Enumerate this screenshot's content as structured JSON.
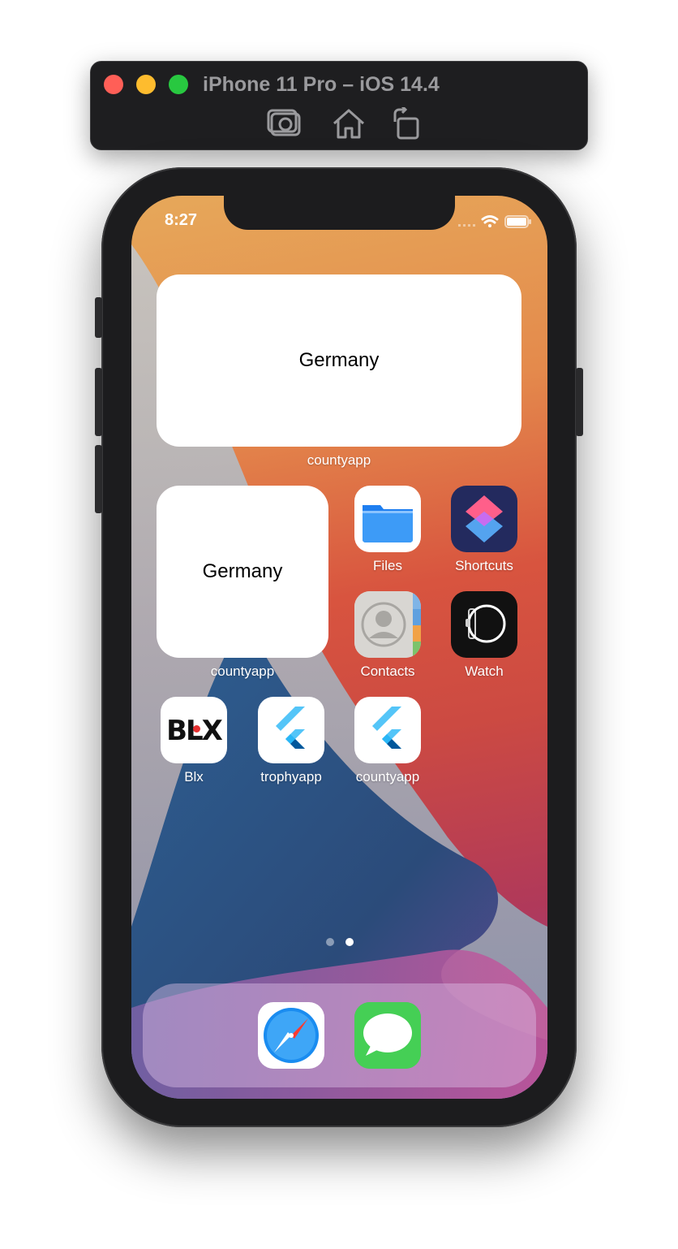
{
  "simulator": {
    "title": "iPhone 11 Pro – iOS 14.4",
    "buttons": [
      "screenshot-icon",
      "home-icon",
      "rotate-icon"
    ]
  },
  "status_bar": {
    "time": "8:27",
    "icons": [
      "cellular-icon",
      "wifi-icon",
      "battery-icon"
    ]
  },
  "widgets": {
    "large": {
      "text": "Germany",
      "label": "countyapp"
    },
    "small": {
      "text": "Germany",
      "label": "countyapp"
    }
  },
  "apps": {
    "files": "Files",
    "shortcuts": "Shortcuts",
    "contacts": "Contacts",
    "watch": "Watch",
    "blx": "Blx",
    "trophyapp": "trophyapp",
    "countyapp": "countyapp",
    "blx_logo": "BLX"
  },
  "dock": {
    "apps": [
      "safari-icon",
      "messages-icon"
    ]
  },
  "page_indicator": {
    "pages": 2,
    "current": 2
  }
}
